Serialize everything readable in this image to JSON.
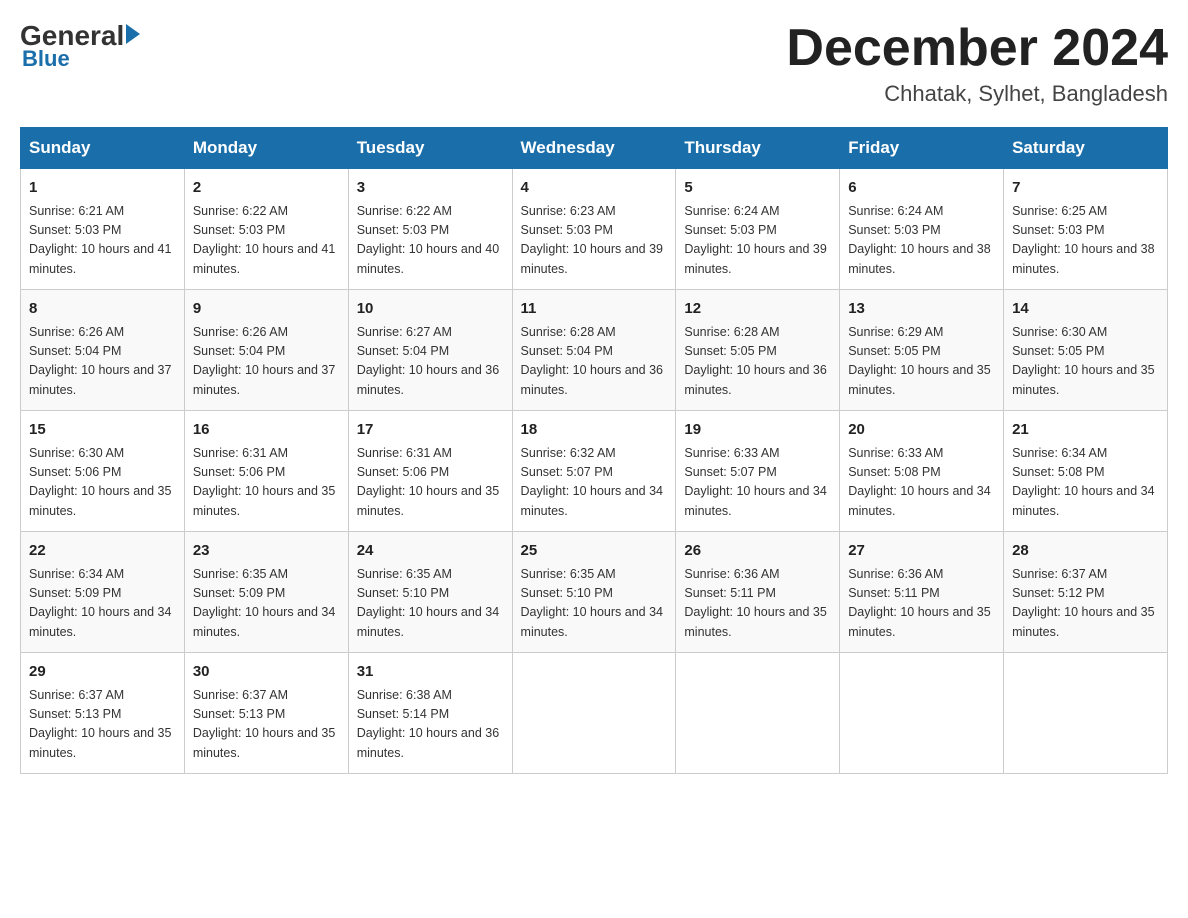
{
  "logo": {
    "general": "General",
    "triangle": "",
    "blue": "Blue"
  },
  "title": "December 2024",
  "subtitle": "Chhatak, Sylhet, Bangladesh",
  "days_of_week": [
    "Sunday",
    "Monday",
    "Tuesday",
    "Wednesday",
    "Thursday",
    "Friday",
    "Saturday"
  ],
  "weeks": [
    [
      {
        "num": "1",
        "sunrise": "6:21 AM",
        "sunset": "5:03 PM",
        "daylight": "10 hours and 41 minutes."
      },
      {
        "num": "2",
        "sunrise": "6:22 AM",
        "sunset": "5:03 PM",
        "daylight": "10 hours and 41 minutes."
      },
      {
        "num": "3",
        "sunrise": "6:22 AM",
        "sunset": "5:03 PM",
        "daylight": "10 hours and 40 minutes."
      },
      {
        "num": "4",
        "sunrise": "6:23 AM",
        "sunset": "5:03 PM",
        "daylight": "10 hours and 39 minutes."
      },
      {
        "num": "5",
        "sunrise": "6:24 AM",
        "sunset": "5:03 PM",
        "daylight": "10 hours and 39 minutes."
      },
      {
        "num": "6",
        "sunrise": "6:24 AM",
        "sunset": "5:03 PM",
        "daylight": "10 hours and 38 minutes."
      },
      {
        "num": "7",
        "sunrise": "6:25 AM",
        "sunset": "5:03 PM",
        "daylight": "10 hours and 38 minutes."
      }
    ],
    [
      {
        "num": "8",
        "sunrise": "6:26 AM",
        "sunset": "5:04 PM",
        "daylight": "10 hours and 37 minutes."
      },
      {
        "num": "9",
        "sunrise": "6:26 AM",
        "sunset": "5:04 PM",
        "daylight": "10 hours and 37 minutes."
      },
      {
        "num": "10",
        "sunrise": "6:27 AM",
        "sunset": "5:04 PM",
        "daylight": "10 hours and 36 minutes."
      },
      {
        "num": "11",
        "sunrise": "6:28 AM",
        "sunset": "5:04 PM",
        "daylight": "10 hours and 36 minutes."
      },
      {
        "num": "12",
        "sunrise": "6:28 AM",
        "sunset": "5:05 PM",
        "daylight": "10 hours and 36 minutes."
      },
      {
        "num": "13",
        "sunrise": "6:29 AM",
        "sunset": "5:05 PM",
        "daylight": "10 hours and 35 minutes."
      },
      {
        "num": "14",
        "sunrise": "6:30 AM",
        "sunset": "5:05 PM",
        "daylight": "10 hours and 35 minutes."
      }
    ],
    [
      {
        "num": "15",
        "sunrise": "6:30 AM",
        "sunset": "5:06 PM",
        "daylight": "10 hours and 35 minutes."
      },
      {
        "num": "16",
        "sunrise": "6:31 AM",
        "sunset": "5:06 PM",
        "daylight": "10 hours and 35 minutes."
      },
      {
        "num": "17",
        "sunrise": "6:31 AM",
        "sunset": "5:06 PM",
        "daylight": "10 hours and 35 minutes."
      },
      {
        "num": "18",
        "sunrise": "6:32 AM",
        "sunset": "5:07 PM",
        "daylight": "10 hours and 34 minutes."
      },
      {
        "num": "19",
        "sunrise": "6:33 AM",
        "sunset": "5:07 PM",
        "daylight": "10 hours and 34 minutes."
      },
      {
        "num": "20",
        "sunrise": "6:33 AM",
        "sunset": "5:08 PM",
        "daylight": "10 hours and 34 minutes."
      },
      {
        "num": "21",
        "sunrise": "6:34 AM",
        "sunset": "5:08 PM",
        "daylight": "10 hours and 34 minutes."
      }
    ],
    [
      {
        "num": "22",
        "sunrise": "6:34 AM",
        "sunset": "5:09 PM",
        "daylight": "10 hours and 34 minutes."
      },
      {
        "num": "23",
        "sunrise": "6:35 AM",
        "sunset": "5:09 PM",
        "daylight": "10 hours and 34 minutes."
      },
      {
        "num": "24",
        "sunrise": "6:35 AM",
        "sunset": "5:10 PM",
        "daylight": "10 hours and 34 minutes."
      },
      {
        "num": "25",
        "sunrise": "6:35 AM",
        "sunset": "5:10 PM",
        "daylight": "10 hours and 34 minutes."
      },
      {
        "num": "26",
        "sunrise": "6:36 AM",
        "sunset": "5:11 PM",
        "daylight": "10 hours and 35 minutes."
      },
      {
        "num": "27",
        "sunrise": "6:36 AM",
        "sunset": "5:11 PM",
        "daylight": "10 hours and 35 minutes."
      },
      {
        "num": "28",
        "sunrise": "6:37 AM",
        "sunset": "5:12 PM",
        "daylight": "10 hours and 35 minutes."
      }
    ],
    [
      {
        "num": "29",
        "sunrise": "6:37 AM",
        "sunset": "5:13 PM",
        "daylight": "10 hours and 35 minutes."
      },
      {
        "num": "30",
        "sunrise": "6:37 AM",
        "sunset": "5:13 PM",
        "daylight": "10 hours and 35 minutes."
      },
      {
        "num": "31",
        "sunrise": "6:38 AM",
        "sunset": "5:14 PM",
        "daylight": "10 hours and 36 minutes."
      },
      null,
      null,
      null,
      null
    ]
  ],
  "labels": {
    "sunrise_prefix": "Sunrise: ",
    "sunset_prefix": "Sunset: ",
    "daylight_prefix": "Daylight: "
  }
}
